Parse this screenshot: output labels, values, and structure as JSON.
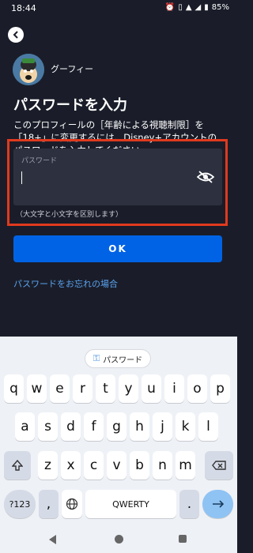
{
  "status": {
    "time": "18:44",
    "battery": "85%"
  },
  "profile": {
    "name": "グーフィー"
  },
  "page": {
    "title": "パスワードを入力",
    "description": "このプロフィールの［年齢による視聴制限］を「18+」に変更するには、Disney+アカウントのパスワードを入力してください。",
    "password_label": "パスワード",
    "password_value": "",
    "hint": "（大文字と小文字を区別します）",
    "ok_label": "OK",
    "forgot_link": "パスワードをお忘れの場合"
  },
  "keyboard": {
    "suggestion": "パスワード",
    "row1": [
      "q",
      "w",
      "e",
      "r",
      "t",
      "y",
      "u",
      "i",
      "o",
      "p"
    ],
    "row2": [
      "a",
      "s",
      "d",
      "f",
      "g",
      "h",
      "j",
      "k",
      "l"
    ],
    "row3": [
      "z",
      "x",
      "c",
      "v",
      "b",
      "n",
      "m"
    ],
    "symbols_key": "?123",
    "comma_key": ",",
    "space_label": "QWERTY",
    "period_key": "."
  },
  "icons": {
    "back": "back-arrow-icon",
    "eye": "eye-off-icon",
    "key": "key-icon",
    "shift": "shift-icon",
    "backspace": "backspace-icon",
    "globe": "globe-icon",
    "enter": "enter-arrow-icon"
  },
  "colors": {
    "background": "#1a1d29",
    "accent": "#0063e5",
    "highlight": "#e03a1e",
    "link": "#5aa3f0"
  }
}
